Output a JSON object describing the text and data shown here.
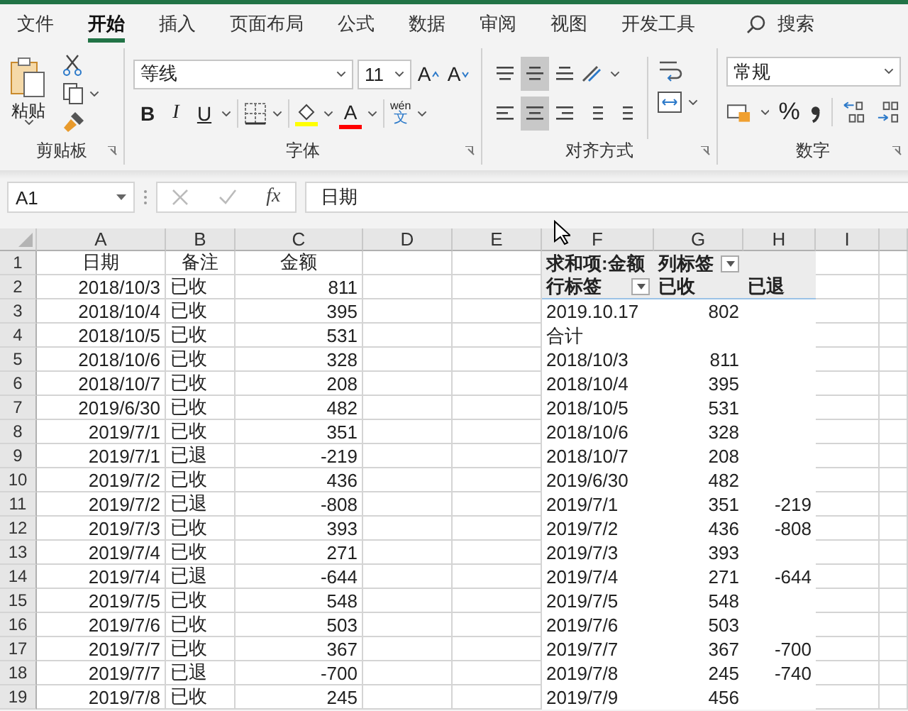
{
  "ribbon": {
    "tabs": [
      {
        "label": "文件",
        "selected": false
      },
      {
        "label": "开始",
        "selected": true
      },
      {
        "label": "插入",
        "selected": false
      },
      {
        "label": "页面布局",
        "selected": false
      },
      {
        "label": "公式",
        "selected": false
      },
      {
        "label": "数据",
        "selected": false
      },
      {
        "label": "审阅",
        "selected": false
      },
      {
        "label": "视图",
        "selected": false
      },
      {
        "label": "开发工具",
        "selected": false
      }
    ],
    "search": "搜索",
    "clipboard": {
      "paste": "粘贴",
      "label": "剪贴板"
    },
    "font": {
      "name": "等线",
      "size": "11",
      "grow": "A",
      "shrink": "A",
      "bold": "B",
      "italic": "I",
      "underline": "U",
      "font_color": "A",
      "phonetic": "wén",
      "phonetic_char": "文",
      "label": "字体"
    },
    "alignment": {
      "label": "对齐方式"
    },
    "number": {
      "format": "常规",
      "percent": "%",
      "label": "数字"
    }
  },
  "formula_bar": {
    "name_box": "A1",
    "fx": "fx",
    "formula": "日期"
  },
  "sheet": {
    "columns": [
      "A",
      "B",
      "C",
      "D",
      "E",
      "F",
      "G",
      "H",
      "I"
    ],
    "rows": [
      {
        "number": "1",
        "kind": "header",
        "pivot_header": true,
        "cells": {
          "A": "日期",
          "B": "备注",
          "C": "金额",
          "F": "求和项:金额",
          "G": {
            "text": "列标签",
            "filter": true
          }
        }
      },
      {
        "number": "2",
        "kind": "data",
        "pivot_header": true,
        "cells": {
          "A": "2018/10/3",
          "B": "已收",
          "C": "811",
          "F": {
            "text": "行标签",
            "filter": true
          },
          "G": "已收",
          "H": "已退"
        }
      },
      {
        "number": "3",
        "kind": "data",
        "pivot_header": false,
        "cells": {
          "A": "2018/10/4",
          "B": "已收",
          "C": "395",
          "F": "2019.10.17",
          "G": "802"
        }
      },
      {
        "number": "4",
        "kind": "data",
        "pivot_header": false,
        "cells": {
          "A": "2018/10/5",
          "B": "已收",
          "C": "531",
          "F": "合计"
        }
      },
      {
        "number": "5",
        "kind": "data",
        "pivot_header": false,
        "cells": {
          "A": "2018/10/6",
          "B": "已收",
          "C": "328",
          "F": "2018/10/3",
          "G": "811"
        }
      },
      {
        "number": "6",
        "kind": "data",
        "pivot_header": false,
        "cells": {
          "A": "2018/10/7",
          "B": "已收",
          "C": "208",
          "F": "2018/10/4",
          "G": "395"
        }
      },
      {
        "number": "7",
        "kind": "data",
        "pivot_header": false,
        "cells": {
          "A": "2019/6/30",
          "B": "已收",
          "C": "482",
          "F": "2018/10/5",
          "G": "531"
        }
      },
      {
        "number": "8",
        "kind": "data",
        "pivot_header": false,
        "cells": {
          "A": "2019/7/1",
          "B": "已收",
          "C": "351",
          "F": "2018/10/6",
          "G": "328"
        }
      },
      {
        "number": "9",
        "kind": "data",
        "pivot_header": false,
        "cells": {
          "A": "2019/7/1",
          "B": "已退",
          "C": "-219",
          "F": "2018/10/7",
          "G": "208"
        }
      },
      {
        "number": "10",
        "kind": "data",
        "pivot_header": false,
        "cells": {
          "A": "2019/7/2",
          "B": "已收",
          "C": "436",
          "F": "2019/6/30",
          "G": "482"
        }
      },
      {
        "number": "11",
        "kind": "data",
        "pivot_header": false,
        "cells": {
          "A": "2019/7/2",
          "B": "已退",
          "C": "-808",
          "F": "2019/7/1",
          "G": "351",
          "H": "-219"
        }
      },
      {
        "number": "12",
        "kind": "data",
        "pivot_header": false,
        "cells": {
          "A": "2019/7/3",
          "B": "已收",
          "C": "393",
          "F": "2019/7/2",
          "G": "436",
          "H": "-808"
        }
      },
      {
        "number": "13",
        "kind": "data",
        "pivot_header": false,
        "cells": {
          "A": "2019/7/4",
          "B": "已收",
          "C": "271",
          "F": "2019/7/3",
          "G": "393"
        }
      },
      {
        "number": "14",
        "kind": "data",
        "pivot_header": false,
        "cells": {
          "A": "2019/7/4",
          "B": "已退",
          "C": "-644",
          "F": "2019/7/4",
          "G": "271",
          "H": "-644"
        }
      },
      {
        "number": "15",
        "kind": "data",
        "pivot_header": false,
        "cells": {
          "A": "2019/7/5",
          "B": "已收",
          "C": "548",
          "F": "2019/7/5",
          "G": "548"
        }
      },
      {
        "number": "16",
        "kind": "data",
        "pivot_header": false,
        "cells": {
          "A": "2019/7/6",
          "B": "已收",
          "C": "503",
          "F": "2019/7/6",
          "G": "503"
        }
      },
      {
        "number": "17",
        "kind": "data",
        "pivot_header": false,
        "cells": {
          "A": "2019/7/7",
          "B": "已收",
          "C": "367",
          "F": "2019/7/7",
          "G": "367",
          "H": "-700"
        }
      },
      {
        "number": "18",
        "kind": "data",
        "pivot_header": false,
        "cells": {
          "A": "2019/7/7",
          "B": "已退",
          "C": "-700",
          "F": "2019/7/8",
          "G": "245",
          "H": "-740"
        }
      },
      {
        "number": "19",
        "kind": "data",
        "pivot_header": false,
        "cells": {
          "A": "2019/7/8",
          "B": "已收",
          "C": "245",
          "F": "2019/7/9",
          "G": "456"
        }
      }
    ]
  }
}
